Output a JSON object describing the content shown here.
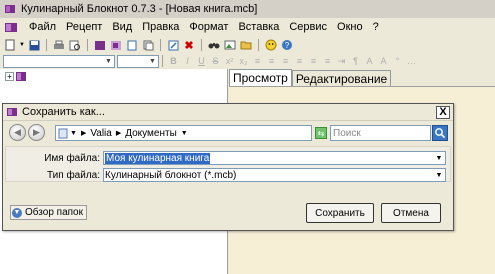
{
  "app": {
    "title": "Кулинарный Блокнот 0.7.3 - [Новая книга.mcb]"
  },
  "menu": {
    "items": [
      "Файл",
      "Рецепт",
      "Вид",
      "Правка",
      "Формат",
      "Вставка",
      "Сервис",
      "Окно",
      "?"
    ]
  },
  "tabs": {
    "view": "Просмотр",
    "edit": "Редактирование"
  },
  "dialog": {
    "title": "Сохранить как...",
    "close_label": "X",
    "path": {
      "user": "Valia",
      "folder": "Документы"
    },
    "search_placeholder": "Поиск",
    "filename_label": "Имя файла:",
    "filename_value": "Моя кулинарная книга",
    "filetype_label": "Тип файла:",
    "filetype_value": "Кулинарный блокнот (*.mcb)",
    "browse_label": "Обзор папок",
    "save_label": "Сохранить",
    "cancel_label": "Отмена"
  },
  "colors": {
    "accent": "#316ac5",
    "content_bg": "#f7eed6",
    "book_icon": "#7a2f8c"
  }
}
